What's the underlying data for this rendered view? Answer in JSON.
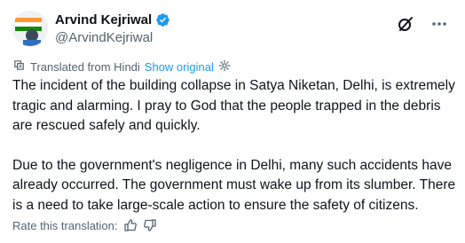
{
  "author": {
    "display_name": "Arvind Kejriwal",
    "handle": "@ArvindKejriwal",
    "verified_color": "#1d9bf0"
  },
  "translation": {
    "label": "Translated from Hindi",
    "show_original": "Show original"
  },
  "body": {
    "paragraph_1": "The incident of the building collapse in Satya Niketan, Delhi, is extremely tragic and alarming. I pray to God that the people trapped in the debris are rescued safely and quickly.",
    "paragraph_2": "Due to the government's negligence in Delhi, many such accidents have already occurred. The government must wake up from its slumber. There is a need to take large-scale action to ensure the safety of citizens."
  },
  "rating": {
    "label": "Rate this translation:"
  },
  "icons": {
    "header_right_1": "grok-icon",
    "header_right_2": "more-icon",
    "translate": "translate-icon",
    "settings": "gear-icon",
    "rate_up": "thumbs-up-icon",
    "rate_down": "thumbs-down-icon"
  },
  "colors": {
    "accent": "#1d9bf0",
    "text": "#0f1419",
    "secondary": "#536471"
  }
}
